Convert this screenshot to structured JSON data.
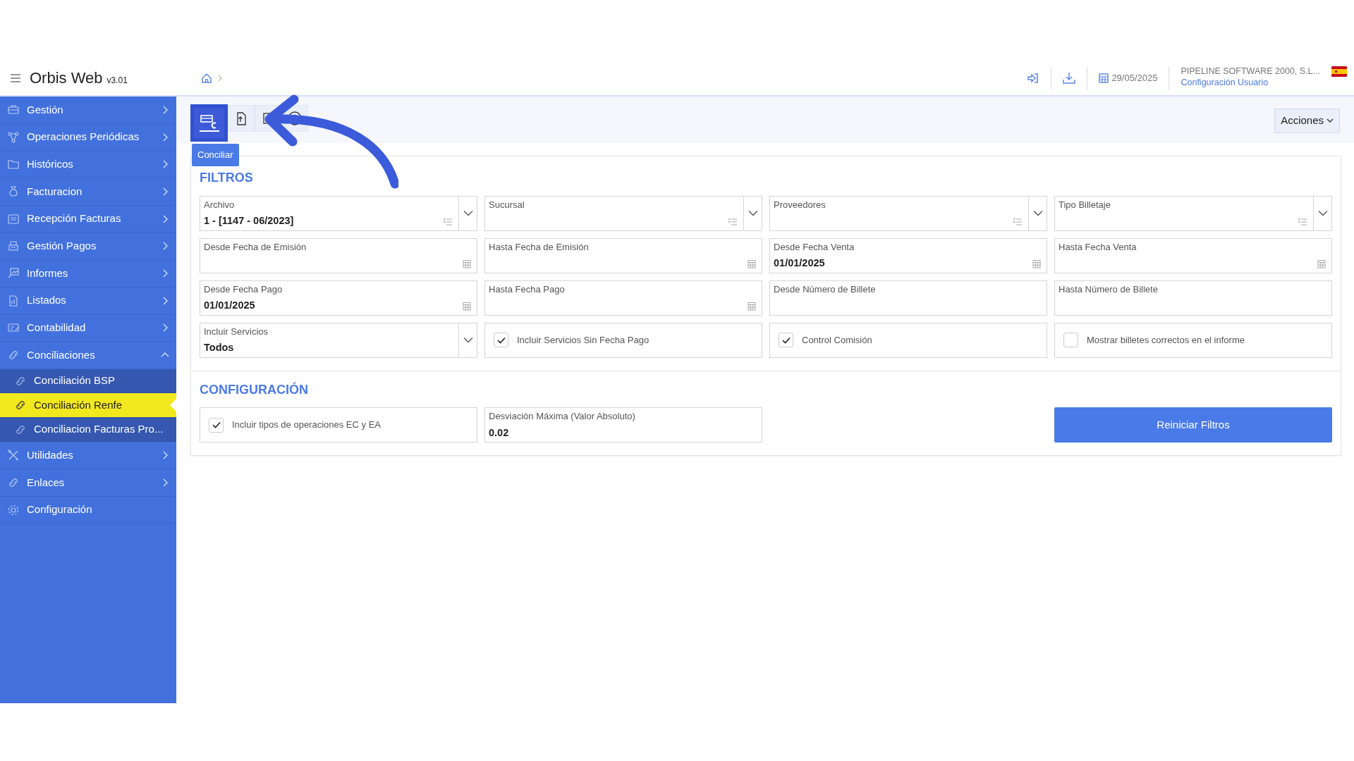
{
  "header": {
    "title": "Orbis Web",
    "version": "v3.01",
    "date": "29/05/2025",
    "company": "PIPELINE SOFTWARE 2000, S.L...",
    "user_link": "Configuración Usuario"
  },
  "sidebar": {
    "items": [
      {
        "label": "Gestión",
        "expanded": false
      },
      {
        "label": "Operaciones Periódicas",
        "expanded": false
      },
      {
        "label": "Históricos",
        "expanded": false
      },
      {
        "label": "Facturacion",
        "expanded": false
      },
      {
        "label": "Recepción Facturas",
        "expanded": false
      },
      {
        "label": "Gestión Pagos",
        "expanded": false
      },
      {
        "label": "Informes",
        "expanded": false
      },
      {
        "label": "Listados",
        "expanded": false
      },
      {
        "label": "Contabilidad",
        "expanded": false
      },
      {
        "label": "Conciliaciones",
        "expanded": true,
        "children": [
          {
            "label": "Conciliación BSP",
            "selected": false
          },
          {
            "label": "Conciliación Renfe",
            "selected": true
          },
          {
            "label": "Conciliacion Facturas Pro...",
            "selected": false
          }
        ]
      },
      {
        "label": "Utilidades",
        "expanded": false
      },
      {
        "label": "Enlaces",
        "expanded": false
      },
      {
        "label": "Configuración"
      }
    ]
  },
  "toolbar": {
    "buttons": [
      {
        "selected": true
      },
      {
        "selected": false
      },
      {
        "selected": false
      },
      {
        "selected": false
      }
    ],
    "tooltip": "Conciliar",
    "actions": "Acciones"
  },
  "filters": {
    "title": "FILTROS",
    "fields": [
      {
        "kind": "multiselect",
        "label": "Archivo",
        "value": "1 - [1147 - 06/2023]"
      },
      {
        "kind": "multiselect",
        "label": "Sucursal"
      },
      {
        "kind": "multiselect",
        "label": "Proveedores"
      },
      {
        "kind": "multiselect",
        "label": "Tipo Billetaje"
      },
      {
        "kind": "date",
        "label": "Desde Fecha de Emisión"
      },
      {
        "kind": "date",
        "label": "Hasta Fecha de Emisión"
      },
      {
        "kind": "date",
        "label": "Desde Fecha Venta",
        "value": "01/01/2025"
      },
      {
        "kind": "date",
        "label": "Hasta Fecha Venta"
      },
      {
        "kind": "date",
        "label": "Desde Fecha Pago",
        "value": "01/01/2025"
      },
      {
        "kind": "date",
        "label": "Hasta Fecha Pago"
      },
      {
        "kind": "text",
        "label": "Desde Número de Billete"
      },
      {
        "kind": "text",
        "label": "Hasta Número de Billete"
      },
      {
        "kind": "select",
        "label": "Incluir Servicios",
        "value": "Todos"
      },
      {
        "kind": "checkbox",
        "label": "Incluir Servicios Sin Fecha Pago",
        "checked": true
      },
      {
        "kind": "checkbox",
        "label": "Control Comisión",
        "checked": true
      },
      {
        "kind": "checkbox",
        "label": "Mostrar billetes correctos en el informe",
        "checked": false
      }
    ]
  },
  "configuration": {
    "title": "CONFIGURACIÓN",
    "fields": [
      {
        "kind": "checkbox",
        "label": "Incluir tipos de operaciones EC y EA",
        "checked": true
      },
      {
        "kind": "text",
        "label": "Desviación Máxima (Valor Absoluto)",
        "value": "0.02"
      }
    ],
    "reset_button": "Reiniciar Filtros"
  }
}
